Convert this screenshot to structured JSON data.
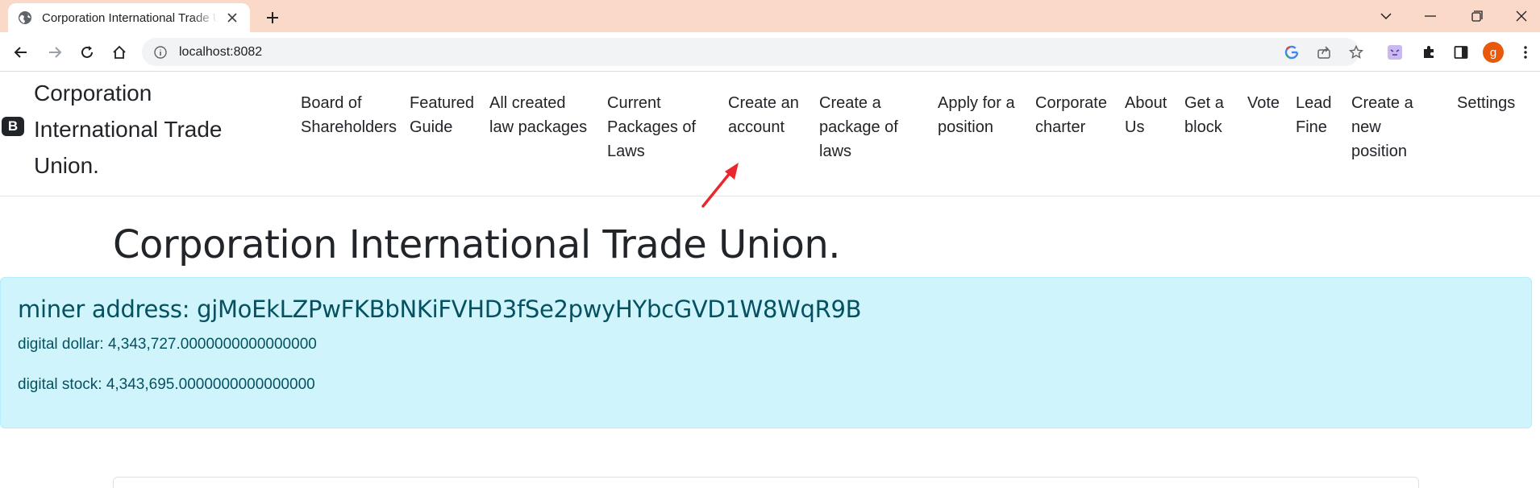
{
  "browser": {
    "tab_title": "Corporation International Trade U",
    "url": "localhost:8082",
    "profile_initial": "g"
  },
  "navbar": {
    "brand_icon": "B",
    "brand_lines": [
      "Corporation",
      "International Trade",
      "Union."
    ],
    "items": [
      {
        "lines": [
          "Board of",
          "Shareholders"
        ]
      },
      {
        "lines": [
          "Featured",
          "Guide"
        ]
      },
      {
        "lines": [
          "All created",
          "law packages"
        ]
      },
      {
        "lines": [
          "Current",
          "Packages of",
          "Laws"
        ]
      },
      {
        "lines": [
          "Create an",
          "account"
        ]
      },
      {
        "lines": [
          "Create a",
          "package of",
          "laws"
        ]
      },
      {
        "lines": [
          "Apply for a",
          "position"
        ]
      },
      {
        "lines": [
          "Corporate",
          "charter"
        ]
      },
      {
        "lines": [
          "About",
          "Us"
        ]
      },
      {
        "lines": [
          "Get a",
          "block"
        ]
      },
      {
        "lines": [
          "Vote"
        ]
      },
      {
        "lines": [
          "Lead",
          "Fine"
        ]
      },
      {
        "lines": [
          "Create a",
          "new",
          "position"
        ]
      },
      {
        "lines": [
          "Settings"
        ]
      }
    ]
  },
  "main": {
    "title": "Corporation International Trade Union.",
    "alert": {
      "heading": "miner address: gjMoEkLZPwFKBbNKiFVHD3fSe2pwyHYbcGVD1W8WqR9B",
      "dollar": "digital dollar: 4,343,727.0000000000000000",
      "stock": "digital stock: 4,343,695.0000000000000000"
    }
  },
  "colors": {
    "tabstrip": "#fad9c8",
    "alert_bg": "#cff4fc",
    "alert_text": "#055160",
    "annotation_arrow": "#e8282b"
  }
}
